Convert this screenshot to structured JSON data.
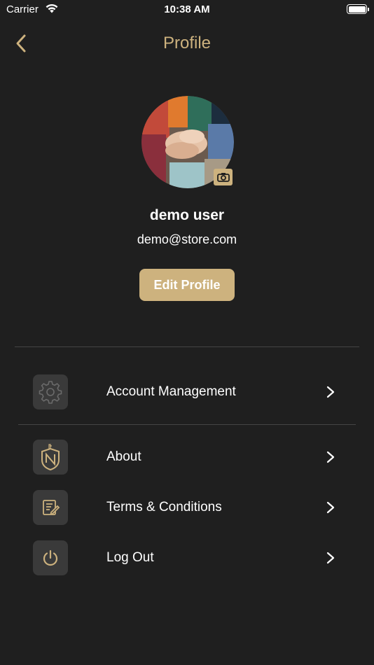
{
  "status_bar": {
    "carrier": "Carrier",
    "time": "10:38 AM"
  },
  "nav": {
    "title": "Profile",
    "back_icon": "chevron-left-icon"
  },
  "profile": {
    "name": "demo user",
    "email": "demo@store.com",
    "edit_label": "Edit Profile",
    "camera_icon": "camera-icon"
  },
  "menu": {
    "items": [
      {
        "label": "Account Management",
        "icon": "gear-icon"
      },
      {
        "label": "About",
        "icon": "shield-logo-icon"
      },
      {
        "label": "Terms & Conditions",
        "icon": "document-edit-icon"
      },
      {
        "label": "Log Out",
        "icon": "power-icon"
      }
    ]
  },
  "colors": {
    "accent": "#cdb27e",
    "background": "#1f1f1f",
    "icon_tile": "#3a3a3a",
    "divider": "#444444"
  }
}
